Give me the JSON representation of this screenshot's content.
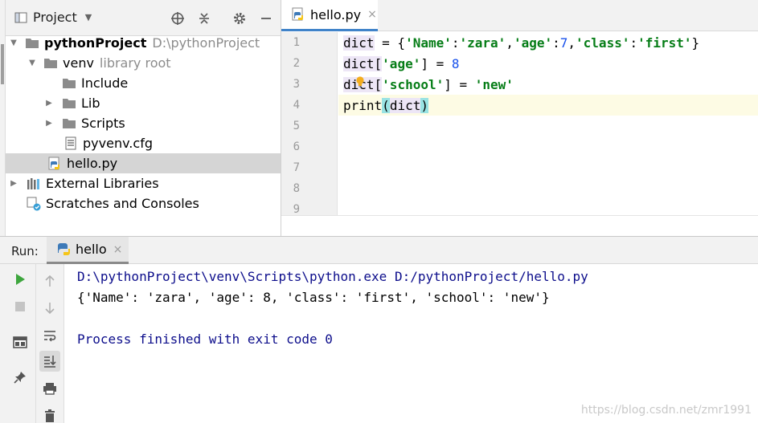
{
  "project_panel": {
    "title": "Project",
    "tree": [
      {
        "label": "pythonProject",
        "hint": "D:\\pythonProject",
        "bold": true
      },
      {
        "label": "venv",
        "hint": "library root"
      },
      {
        "label": "Include"
      },
      {
        "label": "Lib"
      },
      {
        "label": "Scripts"
      },
      {
        "label": "pyvenv.cfg"
      },
      {
        "label": "hello.py"
      },
      {
        "label": "External Libraries"
      },
      {
        "label": "Scratches and Consoles"
      }
    ]
  },
  "editor": {
    "tab": {
      "label": "hello.py",
      "close": "×"
    },
    "line_numbers": [
      "1",
      "2",
      "3",
      "4",
      "5",
      "6",
      "7",
      "8",
      "9"
    ],
    "code": {
      "l1_a": "dict",
      "l1_b": " = {",
      "l1_c": "'Name'",
      "l1_d": ":",
      "l1_e": "'zara'",
      "l1_f": ",",
      "l1_g": "'age'",
      "l1_h": ":",
      "l1_i": "7",
      "l1_j": ",",
      "l1_k": "'class'",
      "l1_l": ":",
      "l1_m": "'first'",
      "l1_n": "}",
      "l2_a": "dict[",
      "l2_b": "'age'",
      "l2_c": "] = ",
      "l2_d": "8",
      "l3_a": "dict[",
      "l3_b": "'school'",
      "l3_c": "] = ",
      "l3_d": "'new'",
      "l4_a": "print",
      "l4_b": "(",
      "l4_c": "dict",
      "l4_d": ")"
    }
  },
  "run_panel": {
    "label": "Run:",
    "tab": {
      "label": "hello",
      "close": "×"
    },
    "console": [
      "D:\\pythonProject\\venv\\Scripts\\python.exe D:/pythonProject/hello.py",
      "{'Name': 'zara', 'age': 8, 'class': 'first', 'school': 'new'}",
      "",
      "Process finished with exit code 0"
    ]
  },
  "watermark": "https://blog.csdn.net/zmr1991",
  "colors": {
    "accent": "#4083c9",
    "string": "#067d17",
    "number": "#1750eb",
    "console_cmd": "#0c0d8b",
    "selection": "#d5d5d5"
  }
}
